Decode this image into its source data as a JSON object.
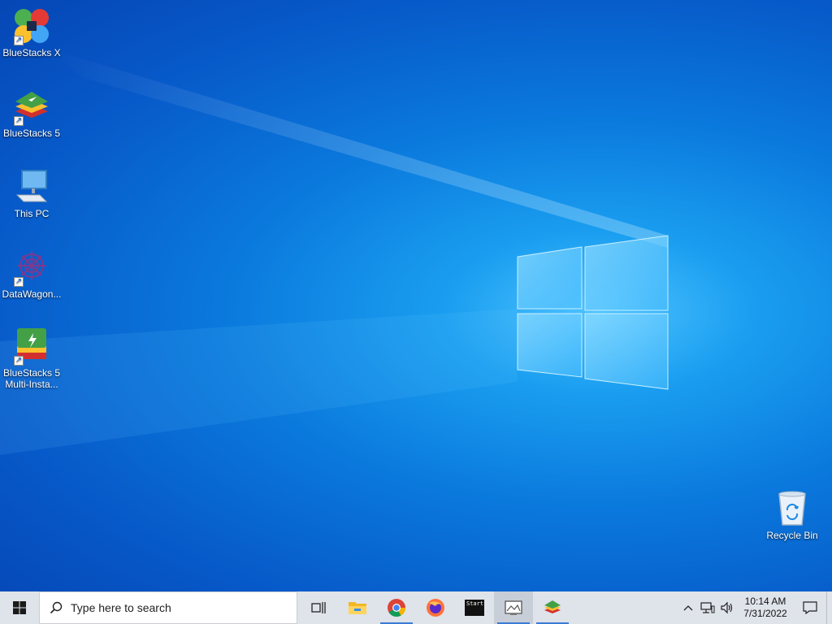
{
  "desktop": {
    "icons": [
      {
        "label": "BlueStacks X",
        "icon": "bluestacks-x-icon"
      },
      {
        "label": "BlueStacks 5",
        "icon": "bluestacks-5-icon"
      },
      {
        "label": "This PC",
        "icon": "computer-icon"
      },
      {
        "label": "DataWagon...",
        "icon": "datawagon-icon"
      },
      {
        "label": "BlueStacks 5 Multi-Insta...",
        "icon": "bluestacks-multi-instance-icon"
      },
      {
        "label": "Recycle Bin",
        "icon": "recycle-bin-icon"
      }
    ]
  },
  "taskbar": {
    "search_placeholder": "Type here to search",
    "apps": [
      {
        "name": "task-view",
        "icon": "task-view-icon"
      },
      {
        "name": "file-explorer",
        "icon": "folder-icon"
      },
      {
        "name": "chrome",
        "icon": "chrome-icon"
      },
      {
        "name": "firefox",
        "icon": "firefox-icon"
      },
      {
        "name": "start-app",
        "icon": "terminal-icon",
        "label": "Start"
      },
      {
        "name": "image-viewer",
        "icon": "image-icon"
      },
      {
        "name": "bluestacks",
        "icon": "bluestacks-icon"
      }
    ],
    "clock": {
      "time": "10:14 AM",
      "date": "7/31/2022"
    }
  },
  "colors": {
    "taskbar": "#dfe3ea",
    "accent": "#3b7bd4",
    "wallpaper": "#0a78dc"
  }
}
